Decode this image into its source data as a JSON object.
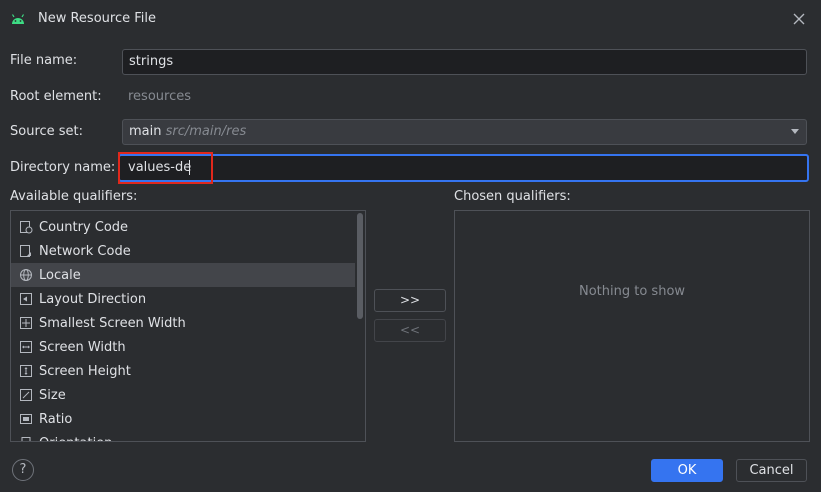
{
  "dialog": {
    "title": "New Resource File"
  },
  "form": {
    "file_name_label": "File name:",
    "file_name_value": "strings",
    "root_element_label": "Root element:",
    "root_element_value": "resources",
    "source_set_label": "Source set:",
    "source_set_value": "main",
    "source_set_hint": "src/main/res",
    "directory_name_label": "Directory name:",
    "directory_name_value": "values-de"
  },
  "qualifiers": {
    "available_label": "Available qualifiers:",
    "chosen_label": "Chosen qualifiers:",
    "chosen_empty_text": "Nothing to show",
    "items": [
      {
        "label": "Country Code",
        "icon": "country-code-icon"
      },
      {
        "label": "Network Code",
        "icon": "network-code-icon"
      },
      {
        "label": "Locale",
        "icon": "globe-icon",
        "selected": true
      },
      {
        "label": "Layout Direction",
        "icon": "layout-direction-icon"
      },
      {
        "label": "Smallest Screen Width",
        "icon": "smallest-screen-width-icon"
      },
      {
        "label": "Screen Width",
        "icon": "screen-width-icon"
      },
      {
        "label": "Screen Height",
        "icon": "screen-height-icon"
      },
      {
        "label": "Size",
        "icon": "size-icon"
      },
      {
        "label": "Ratio",
        "icon": "ratio-icon"
      },
      {
        "label": "Orientation",
        "icon": "orientation-icon"
      }
    ],
    "add_button": ">>",
    "remove_button": "<<"
  },
  "footer": {
    "help": "?",
    "ok": "OK",
    "cancel": "Cancel"
  },
  "colors": {
    "background": "#2b2d30",
    "accent": "#3574f0",
    "highlight": "#e0281c"
  }
}
